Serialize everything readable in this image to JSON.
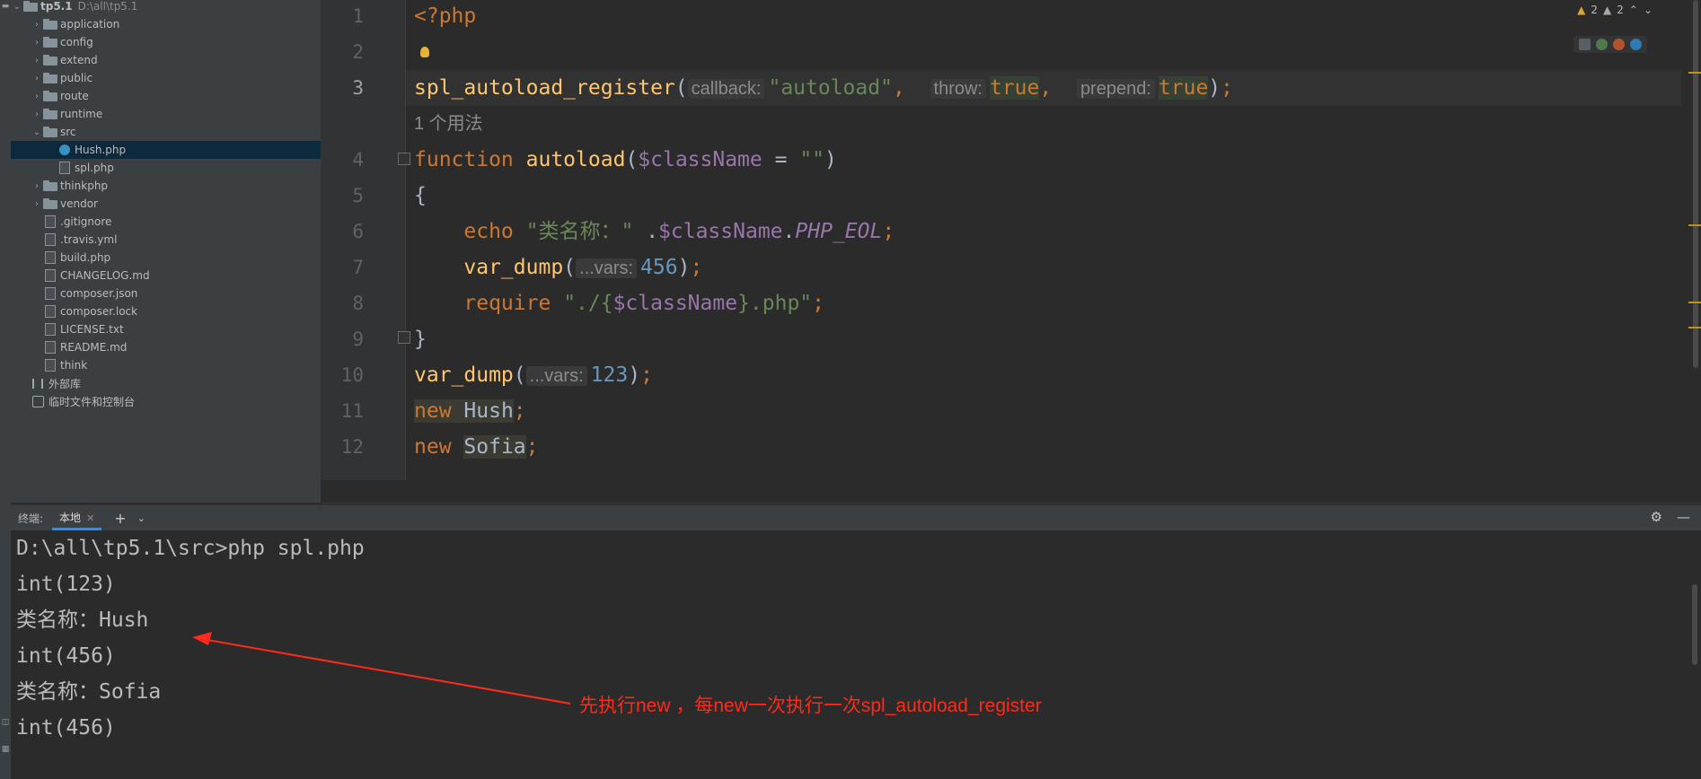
{
  "project": {
    "root_name": "tp5.1",
    "root_path": "D:\\all\\tp5.1",
    "items": [
      {
        "label": "application",
        "type": "folder"
      },
      {
        "label": "config",
        "type": "folder"
      },
      {
        "label": "extend",
        "type": "folder"
      },
      {
        "label": "public",
        "type": "folder"
      },
      {
        "label": "route",
        "type": "folder"
      },
      {
        "label": "runtime",
        "type": "folder"
      },
      {
        "label": "src",
        "type": "folder",
        "expanded": true
      },
      {
        "label": "Hush.php",
        "type": "class",
        "selected": true
      },
      {
        "label": "spl.php",
        "type": "file"
      },
      {
        "label": "thinkphp",
        "type": "folder"
      },
      {
        "label": "vendor",
        "type": "folder"
      },
      {
        "label": ".gitignore",
        "type": "file"
      },
      {
        "label": ".travis.yml",
        "type": "file"
      },
      {
        "label": "build.php",
        "type": "file"
      },
      {
        "label": "CHANGELOG.md",
        "type": "file"
      },
      {
        "label": "composer.json",
        "type": "file"
      },
      {
        "label": "composer.lock",
        "type": "file"
      },
      {
        "label": "LICENSE.txt",
        "type": "file"
      },
      {
        "label": "README.md",
        "type": "file"
      },
      {
        "label": "think",
        "type": "file"
      }
    ],
    "external_libs": "外部库",
    "scratches": "临时文件和控制台"
  },
  "editor": {
    "line_numbers": [
      "1",
      "2",
      "3",
      "4",
      "5",
      "6",
      "7",
      "8",
      "9",
      "10",
      "11",
      "12"
    ],
    "current_line": "3",
    "usage_hint": "1 个用法",
    "code": {
      "l1": "<?php",
      "l3_fn": "spl_autoload_register",
      "l3_hint1": "callback:",
      "l3_arg1": "\"autoload\"",
      "l3_hint2": "throw:",
      "l3_arg2": "true",
      "l3_hint3": "prepend:",
      "l3_arg3": "true",
      "l4_kw": "function",
      "l4_fn": "autoload",
      "l4_var": "$className",
      "l4_default": "\"\"",
      "l5": "{",
      "l6_kw": "echo",
      "l6_str": "\"类名称：\"",
      "l6_var": "$className",
      "l6_const": "PHP_EOL",
      "l7_fn": "var_dump",
      "l7_hint": "...vars:",
      "l7_num": "456",
      "l8_kw": "require",
      "l8_str1": "\"./{",
      "l8_var": "$className",
      "l8_str2": "}.php\"",
      "l9": "}",
      "l10_fn": "var_dump",
      "l10_hint": "...vars:",
      "l10_num": "123",
      "l11_kw": "new",
      "l11_cls": "Hush",
      "l12_kw": "new",
      "l12_cls": "Sofia"
    },
    "warnings_count": "2",
    "weak_warnings_count": "2"
  },
  "terminal": {
    "title": "终端:",
    "tab": "本地",
    "lines": [
      "D:\\all\\tp5.1\\src>php spl.php",
      "int(123)",
      "类名称：Hush",
      "int(456)",
      "类名称：Sofia",
      "int(456)"
    ]
  },
  "annotation": "先执行new ，每new一次执行一次spl_autoload_register"
}
